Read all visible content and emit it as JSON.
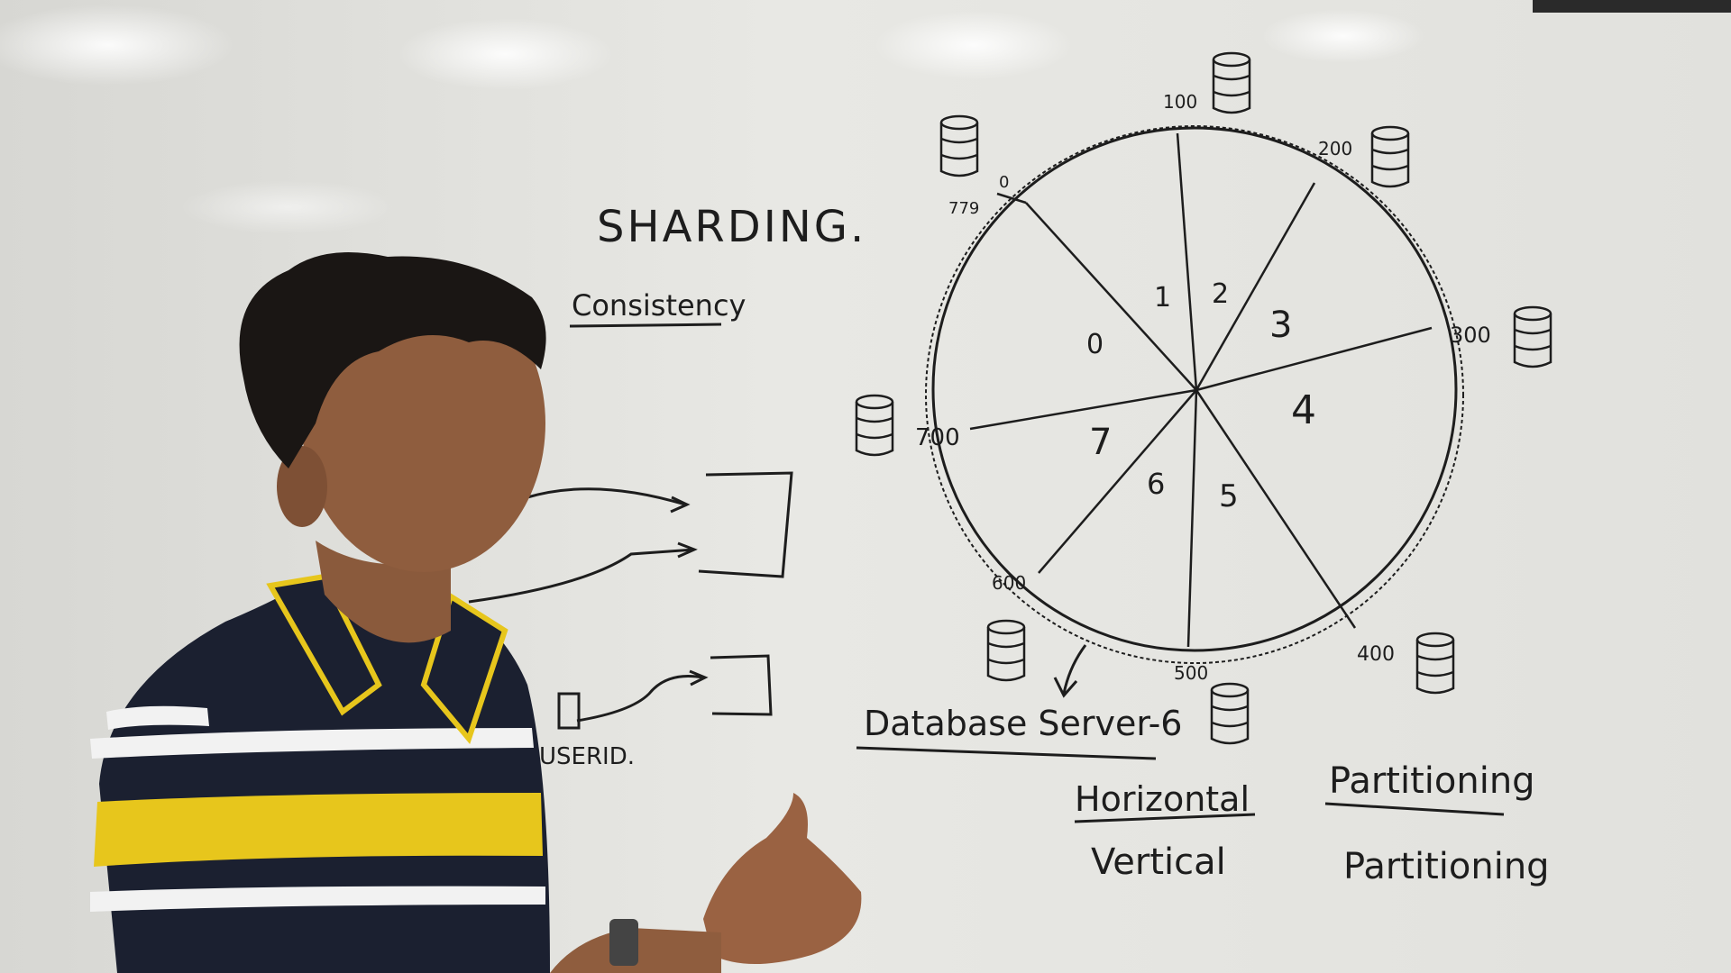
{
  "whiteboard": {
    "title": "SHARDING.",
    "subtitle": "Consistency",
    "userid_label": "USERID.",
    "server_caption": "Database Server-6",
    "notes": {
      "horizontal": "Horizontal",
      "horizontal_partitioning": "Partitioning",
      "vertical": "Vertical",
      "vertical_partitioning": "Partitioning"
    },
    "ring": {
      "marks": [
        "0",
        "779",
        "100",
        "200",
        "300",
        "400",
        "500",
        "600",
        "700"
      ],
      "segments": [
        "0",
        "1",
        "2",
        "3",
        "4",
        "5",
        "6",
        "7"
      ]
    }
  }
}
